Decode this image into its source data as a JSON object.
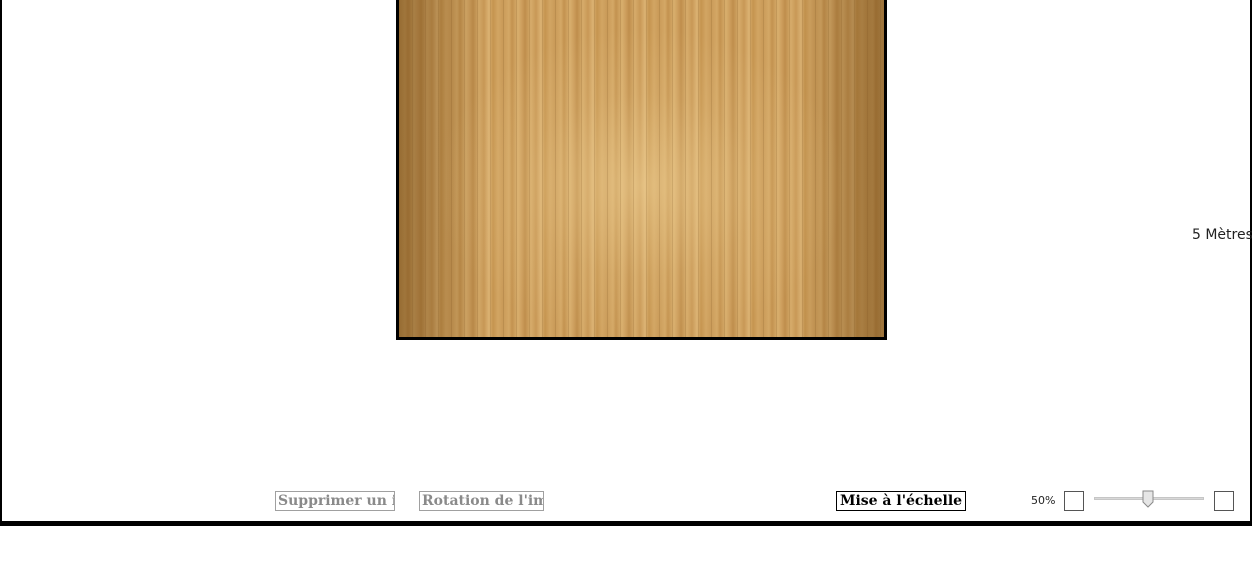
{
  "canvas": {
    "scale_label": "5 Mètres"
  },
  "toolbar": {
    "delete_item_label": "Supprimer un item",
    "rotate_image_label": "Rotation de l'image",
    "scale_button_label": "Mise à l'échelle",
    "zoom_percent": "50%",
    "zoom_value": 0.5
  }
}
